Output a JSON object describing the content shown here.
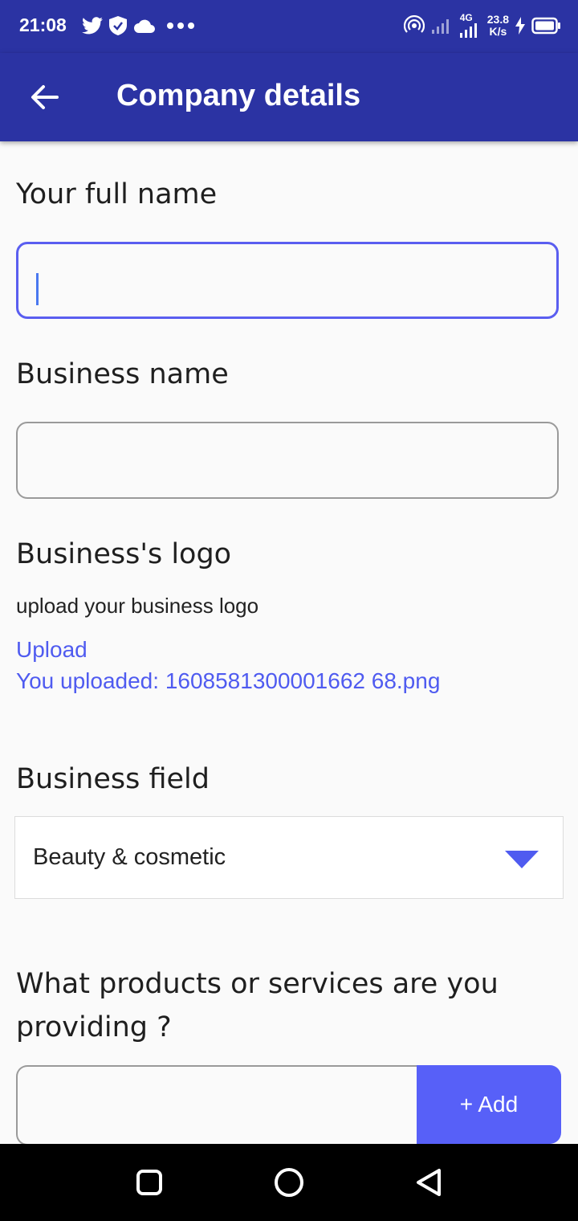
{
  "status_bar": {
    "time": "21:08",
    "network_label": "4G",
    "speed_value": "23.8",
    "speed_unit": "K/s",
    "icons": [
      "twitter-icon",
      "shield-icon",
      "cloud-icon",
      "more-dots-icon",
      "hotspot-icon",
      "signal-icon",
      "charging-icon",
      "battery-icon"
    ]
  },
  "appbar": {
    "title": "Company details",
    "back_icon": "arrow-left-icon"
  },
  "form": {
    "full_name": {
      "label": "Your full name",
      "value": ""
    },
    "business_name": {
      "label": "Business name",
      "value": ""
    },
    "logo": {
      "label": "Business's logo",
      "hint": "upload your business logo",
      "upload_link": "Upload",
      "uploaded_text": "You uploaded: 1608581300001662 68.png"
    },
    "business_field": {
      "label": "Business field",
      "selected": "Beauty & cosmetic"
    },
    "products": {
      "question": "What products or services are you providing ?",
      "value": "",
      "add_label": "+ Add"
    }
  },
  "nav_bar": {
    "buttons": [
      "recents-icon",
      "home-icon",
      "back-triangle-icon"
    ]
  },
  "colors": {
    "primary": "#2b33a3",
    "accent": "#5760f8",
    "link": "#4f5bf0"
  }
}
